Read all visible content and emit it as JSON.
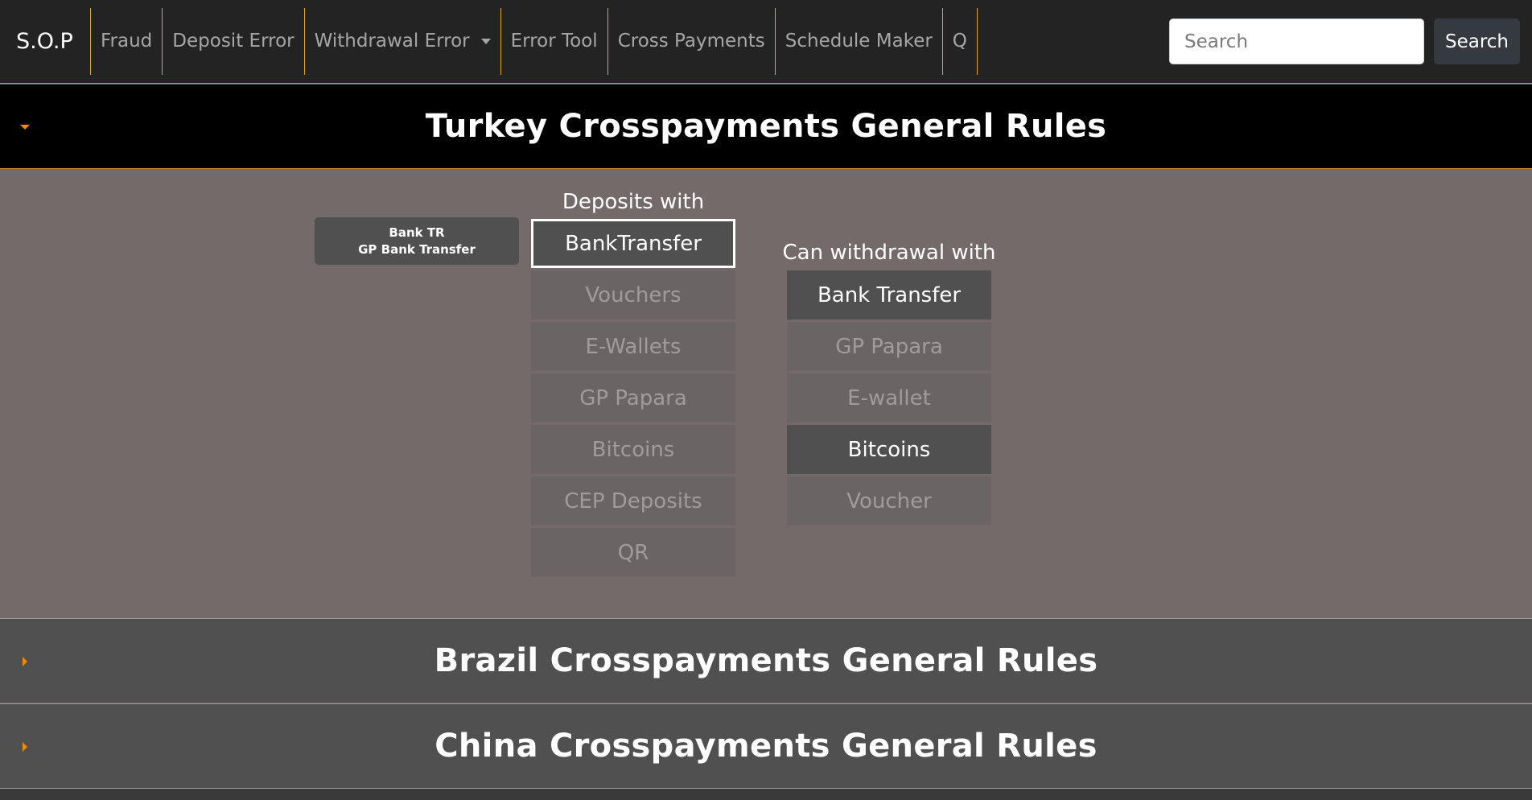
{
  "navbar": {
    "brand": "S.O.P",
    "items": [
      {
        "label": "Fraud"
      },
      {
        "label": "Deposit Error"
      },
      {
        "label": "Withdrawal Error"
      },
      {
        "label": "Error Tool"
      },
      {
        "label": "Cross Payments"
      },
      {
        "label": "Schedule Maker"
      },
      {
        "label": "Q"
      }
    ],
    "search_placeholder": "Search",
    "search_button": "Search"
  },
  "sections": {
    "turkey": {
      "title": "Turkey Crosspayments General Rules",
      "bank_tag": {
        "line1": "Bank TR",
        "line2": "GP Bank Transfer"
      },
      "deposits_title": "Deposits with",
      "deposits": [
        {
          "label": "BankTransfer",
          "state": "selected"
        },
        {
          "label": "Vouchers",
          "state": "inactive"
        },
        {
          "label": "E-Wallets",
          "state": "inactive"
        },
        {
          "label": "GP Papara",
          "state": "inactive"
        },
        {
          "label": "Bitcoins",
          "state": "inactive"
        },
        {
          "label": "CEP Deposits",
          "state": "inactive"
        },
        {
          "label": "QR",
          "state": "inactive"
        }
      ],
      "withdrawals_title": "Can withdrawal with",
      "withdrawals": [
        {
          "label": "Bank Transfer",
          "state": "active"
        },
        {
          "label": "GP Papara",
          "state": "inactive"
        },
        {
          "label": "E-wallet",
          "state": "inactive"
        },
        {
          "label": "Bitcoins",
          "state": "active"
        },
        {
          "label": "Voucher",
          "state": "inactive"
        }
      ]
    },
    "brazil": {
      "title": "Brazil Crosspayments General Rules"
    },
    "china": {
      "title": "China Crosspayments General Rules"
    }
  },
  "colors": {
    "navbar_bg": "#232323",
    "nav_divider": "#d4a82a",
    "accent_arrow": "#f08a00",
    "panel_bg": "#746a6a",
    "active_button": "#505050"
  }
}
